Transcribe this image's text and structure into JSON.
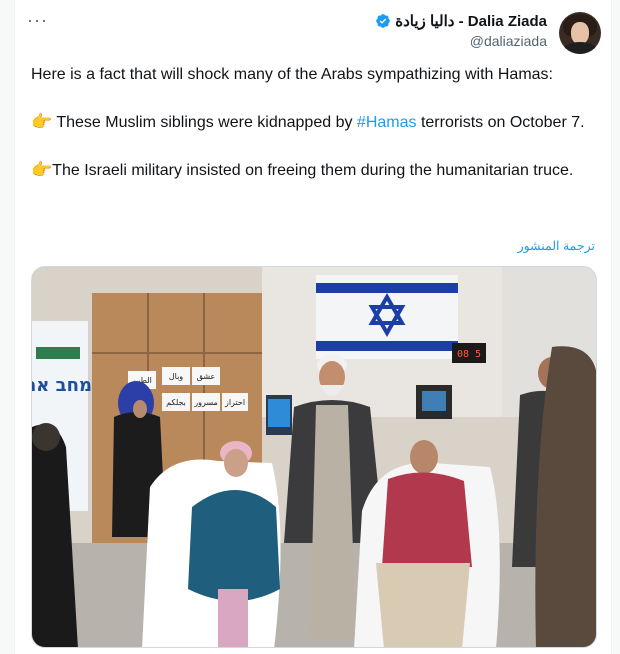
{
  "author": {
    "display_name": "داليا زيادة - Dalia Ziada",
    "handle": "@daliaziada",
    "verified": true,
    "avatar_icon": "profile-photo"
  },
  "menu": {
    "more_label": "···"
  },
  "tweet": {
    "line1": "Here is a fact that will shock many of the Arabs sympathizing with Hamas:",
    "p2_emoji": "👉",
    "p2_before": " These Muslim siblings were kidnapped by ",
    "p2_hashtag": "#Hamas",
    "p2_after": " terrorists on October 7.",
    "p3_emoji": "👉",
    "p3_text": "The Israeli military insisted on freeing them during the humanitarian truce."
  },
  "translate_label": "ترجمة المنشور",
  "photo": {
    "hebrew_sign": "מחב את",
    "cabinet_labels": [
      "عشق",
      "وبال",
      "الطين",
      "مسرور",
      "بجلكم",
      "احتراز"
    ],
    "clock_display": "08 5"
  },
  "colors": {
    "accent": "#1d9bf0",
    "text": "#0f1419",
    "muted": "#536471"
  }
}
